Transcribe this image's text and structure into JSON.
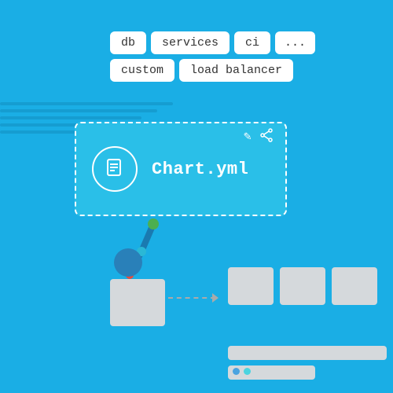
{
  "background_color": "#1aaee5",
  "tags": [
    {
      "id": "db",
      "label": "db"
    },
    {
      "id": "services",
      "label": "services"
    },
    {
      "id": "ci",
      "label": "ci"
    },
    {
      "id": "dots",
      "label": "..."
    },
    {
      "id": "custom",
      "label": "custom"
    },
    {
      "id": "load_balancer",
      "label": "load balancer"
    }
  ],
  "chart_card": {
    "title": "Chart.yml",
    "icon_label": "document-icon",
    "actions": [
      "edit-icon",
      "share-icon"
    ]
  },
  "action_icons": {
    "edit": "✎",
    "share": "⋈"
  },
  "layout": {
    "source_box_label": "source-box",
    "right_boxes_count": 3,
    "bottom_bars_count": 2
  }
}
